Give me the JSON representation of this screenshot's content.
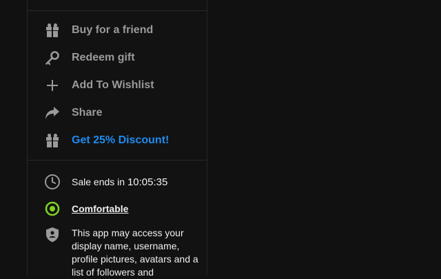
{
  "actions": {
    "buy_for_friend": "Buy for a friend",
    "redeem_gift": "Redeem gift",
    "add_to_wishlist": "Add To Wishlist",
    "share": "Share",
    "discount": "Get 25% Discount!"
  },
  "info": {
    "sale_prefix": "Sale ends in",
    "sale_timer": "10:05:35",
    "comfort_label": "Comfortable",
    "permissions_text": "This app may access your display name, username, profile pictures, avatars and a list of followers and"
  },
  "icons": {
    "buy_for_friend": "gift-icon",
    "redeem_gift": "key-icon",
    "add_to_wishlist": "plus-icon",
    "share": "share-arrow-icon",
    "discount": "gift-icon",
    "sale": "clock-icon",
    "comfort": "target-ring-icon",
    "permissions": "shield-person-icon"
  },
  "colors": {
    "accent": "#1f8cf0",
    "comfort_green": "#7ed321",
    "muted_text": "#9a9a9c"
  }
}
